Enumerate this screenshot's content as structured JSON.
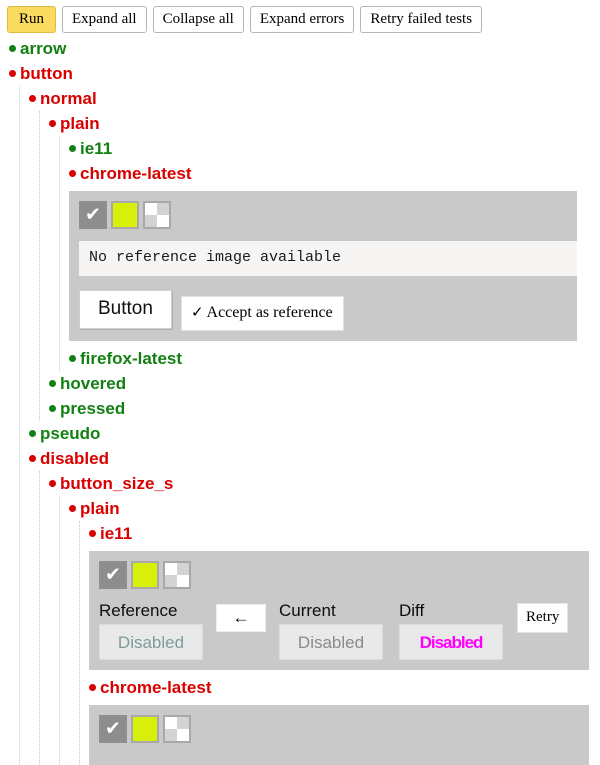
{
  "toolbar": {
    "buttons": [
      {
        "label": "Run",
        "style": "run"
      },
      {
        "label": "Expand all",
        "style": "plain"
      },
      {
        "label": "Collapse all",
        "style": "plain"
      },
      {
        "label": "Expand errors",
        "style": "plain"
      },
      {
        "label": "Retry failed tests",
        "style": "plain"
      }
    ]
  },
  "colors": {
    "pass": "#138013",
    "fail": "#d90000",
    "run_button": "#fadb5f",
    "panel_bg": "#c9c9c9",
    "diff_highlight": "#ff00ff",
    "swatch_yellow": "#d7ef09"
  },
  "tree": {
    "arrow": {
      "label": "arrow",
      "status": "pass"
    },
    "button": {
      "label": "button",
      "status": "fail"
    },
    "normal": {
      "label": "normal",
      "status": "fail"
    },
    "plain": {
      "label": "plain",
      "status": "fail"
    },
    "ie11": {
      "label": "ie11",
      "status": "pass"
    },
    "chrome_latest": {
      "label": "chrome-latest",
      "status": "fail"
    },
    "firefox_latest": {
      "label": "firefox-latest",
      "status": "pass"
    },
    "hovered": {
      "label": "hovered",
      "status": "pass"
    },
    "pressed": {
      "label": "pressed",
      "status": "pass"
    },
    "pseudo": {
      "label": "pseudo",
      "status": "pass"
    },
    "disabled": {
      "label": "disabled",
      "status": "fail"
    },
    "button_size_s": {
      "label": "button_size_s",
      "status": "fail"
    },
    "plain2": {
      "label": "plain",
      "status": "fail"
    },
    "ie11_2": {
      "label": "ie11",
      "status": "fail"
    },
    "chrome_latest_2": {
      "label": "chrome-latest",
      "status": "fail"
    }
  },
  "panel_no_reference": {
    "modes": [
      {
        "name": "show-reference-mode",
        "icon": "check-icon",
        "glyph": "✔",
        "selected": true
      },
      {
        "name": "show-current-mode",
        "icon": "color-swatch-icon",
        "selected": false
      },
      {
        "name": "show-diff-mode",
        "icon": "checkerboard-icon",
        "selected": false
      }
    ],
    "message": "No reference image available",
    "sample_button_label": "Button",
    "accept_label": "Accept as reference",
    "accept_tick": "✓"
  },
  "panel_diff": {
    "modes": [
      {
        "name": "show-reference-mode",
        "icon": "check-icon",
        "glyph": "✔",
        "selected": true
      },
      {
        "name": "show-current-mode",
        "icon": "color-swatch-icon",
        "selected": false
      },
      {
        "name": "show-diff-mode",
        "icon": "checkerboard-icon",
        "selected": false
      }
    ],
    "columns": [
      {
        "heading": "Reference",
        "value": "Disabled",
        "variant": "ref"
      },
      {
        "heading": "Current",
        "value": "Disabled",
        "variant": "cur"
      },
      {
        "heading": "Diff",
        "value": "Disabled",
        "variant": "diff"
      }
    ],
    "arrow_glyph": "←",
    "retry_label": "Retry"
  }
}
